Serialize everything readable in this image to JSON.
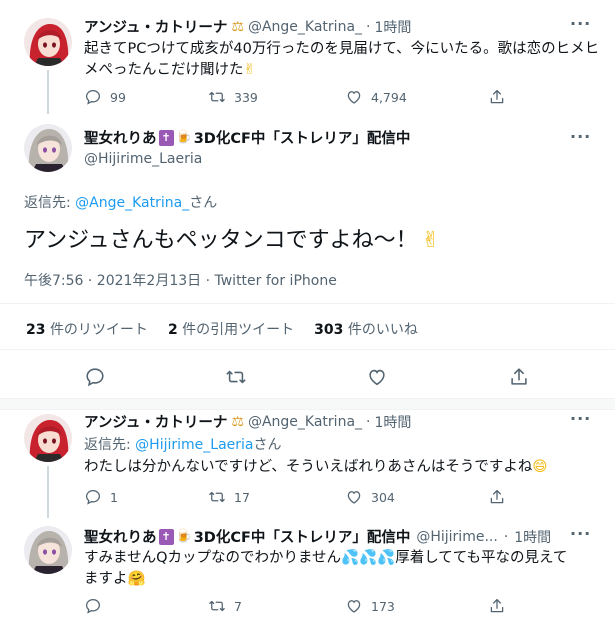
{
  "tweet1": {
    "display_name": "アンジュ・カトリーナ",
    "badge": "⚖",
    "handle": "@Ange_Katrina_",
    "dot": "·",
    "time": "1時間",
    "text": "起きてPCつけて成亥が40万行ったのを見届けて、今にいたる。歌は恋のヒメヒメぺったんこだけ聞けた",
    "emoji": "✌",
    "replies": "99",
    "retweets": "339",
    "likes": "4,794"
  },
  "main": {
    "display_name": "聖女れりあ",
    "cross": "✝",
    "beer": "🍺",
    "name_suffix": "3D化CF中「ストレリア」配信中",
    "handle": "@Hijirime_Laeria",
    "reply_to_label": "返信先:",
    "reply_to_handle": "@Ange_Katrina_",
    "reply_to_suffix": "さん",
    "text": "アンジュさんもペッタンコですよね～！",
    "emoji": "✌",
    "timestamp": "午後7:56 · 2021年2月13日 · Twitter for iPhone",
    "rt_count": "23",
    "rt_label": "件のリツイート",
    "quote_count": "2",
    "quote_label": "件の引用ツイート",
    "like_count": "303",
    "like_label": "件のいいね"
  },
  "reply1": {
    "display_name": "アンジュ・カトリーナ",
    "badge": "⚖",
    "handle": "@Ange_Katrina_",
    "dot": "·",
    "time": "1時間",
    "reply_to_label": "返信先:",
    "reply_to_handle": "@Hijirime_Laeria",
    "reply_to_suffix": "さん",
    "text": "わたしは分かんないですけど、そういえばれりあさんはそうですよね",
    "emoji": "😄",
    "replies": "1",
    "retweets": "17",
    "likes": "304"
  },
  "reply2": {
    "display_name": "聖女れりあ",
    "cross": "✝",
    "beer": "🍺",
    "name_suffix": "3D化CF中「ストレリア」配信中",
    "handle": "@Hijirime...",
    "dot": "·",
    "time": "1時間",
    "text_a": "すみませんQカップなのでわかりません",
    "sweat": "💦💦💦",
    "text_b": "厚着してても平なの見えて",
    "text_c": "ますよ",
    "hug": "🤗",
    "replies": "",
    "retweets": "7",
    "likes": "173"
  },
  "colors": {
    "accent": "#1d9bf0",
    "secondary_text": "#536471",
    "primary_text": "#0f1419"
  },
  "icons": [
    "reply-icon",
    "retweet-icon",
    "like-icon",
    "share-icon",
    "more-icon"
  ]
}
